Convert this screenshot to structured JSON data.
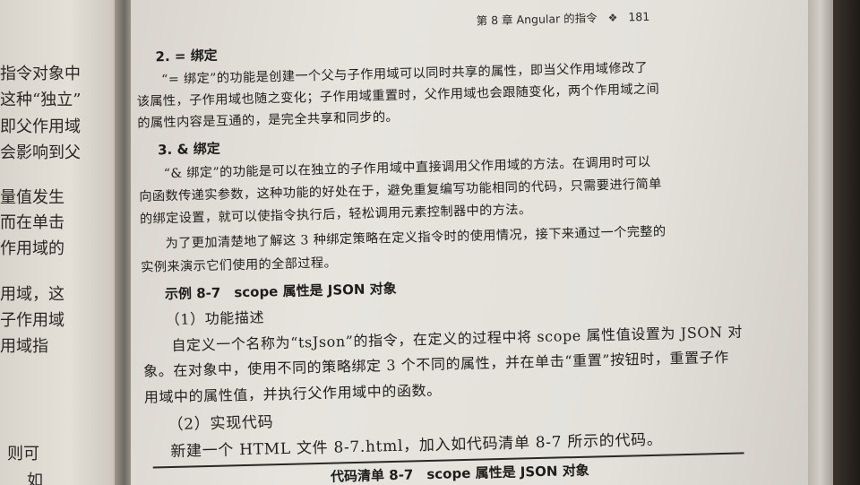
{
  "left_page": {
    "lines": [
      "指令对象中",
      "这种“独立”",
      "即父作用域",
      "会影响到父",
      "量值发生",
      "而在单击",
      "作用域的",
      "用域，这",
      "子作用域",
      "用域指",
      "则可",
      "如"
    ]
  },
  "header": {
    "chapter": "第 8 章",
    "title": "Angular 的指令",
    "page_number": "181"
  },
  "sections": {
    "equal_binding": {
      "heading": "2. = 绑定",
      "lines": [
        "“= 绑定”的功能是创建一个父与子作用域可以同时共享的属性，即当父作用域修改了",
        "该属性，子作用域也随之变化；子作用域重置时，父作用域也会跟随变化，两个作用域之间",
        "的属性内容是互通的，是完全共享和同步的。"
      ]
    },
    "amp_binding": {
      "heading": "3. & 绑定",
      "lines": [
        "“& 绑定”的功能是可以在独立的子作用域中直接调用父作用域的方法。在调用时可以",
        "向函数传递实参数，这种功能的好处在于，避免重复编写功能相同的代码，只需要进行简单",
        "的绑定设置，就可以使指令执行后，轻松调用元素控制器中的方法。",
        "为了更加清楚地了解这 3 种绑定策略在定义指令时的使用情况，接下来通过一个完整的",
        "实例来演示它们使用的全部过程。"
      ]
    },
    "example": {
      "heading": "示例 8-7　scope 属性是 JSON 对象",
      "sub1": "（1）功能描述",
      "desc_lines": [
        "自定义一个名称为“tsJson”的指令，在定义的过程中将 scope 属性值设置为 JSON 对",
        "象。在对象中，使用不同的策略绑定 3 个不同的属性，并在单击“重置”按钮时，重置子作",
        "用域中的属性值，并执行父作用域中的函数。"
      ],
      "sub2": "（2）实现代码",
      "impl_line": "新建一个 HTML 文件 8-7.html，加入如代码清单 8-7 所示的代码。"
    },
    "listing": {
      "title": "代码清单 8-7　scope 属性是 JSON 对象"
    }
  }
}
